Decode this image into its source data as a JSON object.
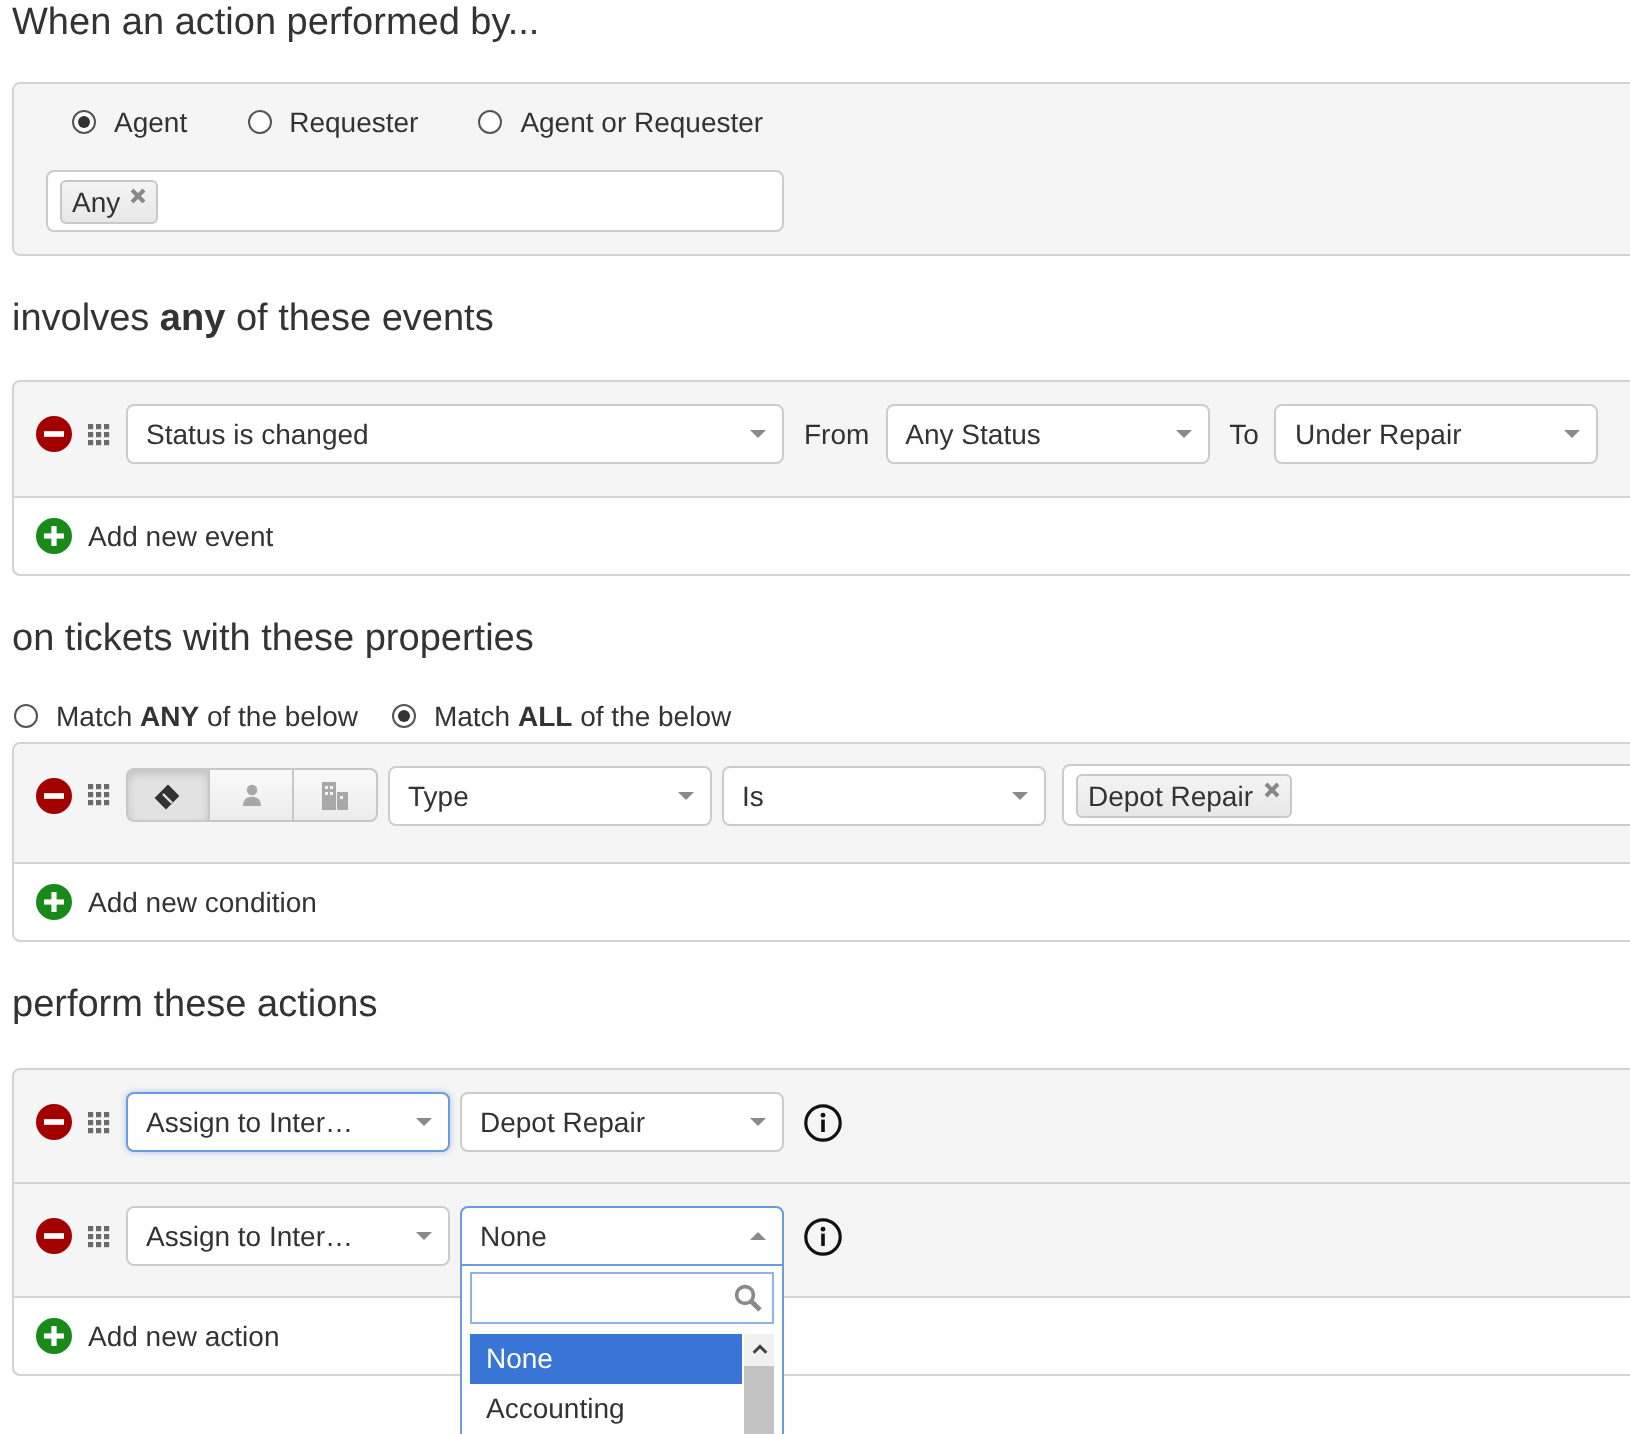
{
  "trigger": {
    "heading": "When an action performed by...",
    "performers": [
      {
        "label": "Agent",
        "selected": true
      },
      {
        "label": "Requester",
        "selected": false
      },
      {
        "label": "Agent or Requester",
        "selected": false
      }
    ],
    "tags": [
      "Any"
    ]
  },
  "events": {
    "heading": "involves **any** of these events",
    "rows": [
      {
        "event": "Status is changed",
        "from_label": "From",
        "from": "Any Status",
        "to_label": "To",
        "to": "Under Repair"
      }
    ],
    "add_label": "Add new event"
  },
  "conditions": {
    "heading": "on tickets with these properties",
    "match": [
      {
        "label": "Match **ANY** of the below",
        "selected": false
      },
      {
        "label": "Match **ALL** of the below",
        "selected": true
      }
    ],
    "rows": [
      {
        "sources": [
          {
            "selected": true
          },
          {
            "selected": false
          },
          {
            "selected": false
          }
        ],
        "field": "Type",
        "operator": "Is",
        "tags": [
          "Depot Repair"
        ]
      }
    ],
    "add_label": "Add new condition"
  },
  "actions": {
    "heading": "perform these actions",
    "rows": [
      {
        "action": {
          "value": "Assign to Inter…",
          "focused": true
        },
        "target": {
          "value": "Depot Repair",
          "open": false
        }
      },
      {
        "action": {
          "value": "Assign to Inter…",
          "focused": false
        },
        "target": {
          "value": "None",
          "open": true,
          "options": [
            {
              "label": "None",
              "selected": true
            },
            {
              "label": "Accounting",
              "selected": false
            }
          ]
        }
      }
    ],
    "add_label": "Add new action"
  }
}
